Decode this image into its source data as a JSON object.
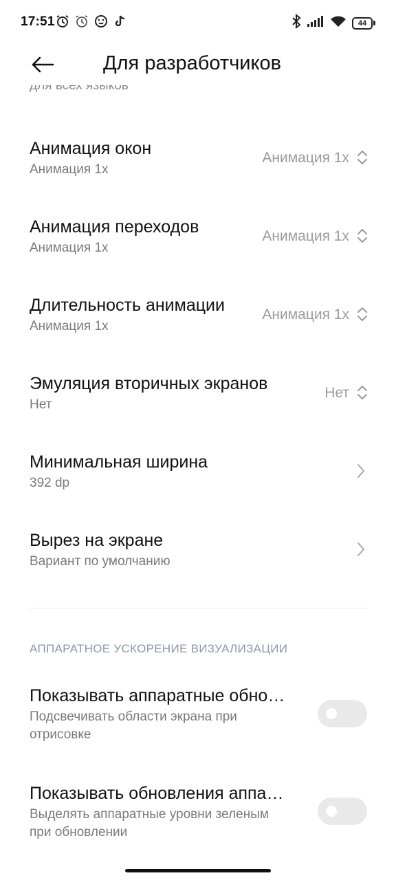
{
  "status_bar": {
    "time": "17:51",
    "battery_level": "44",
    "left_icons": [
      "alarm-icon",
      "alarm-icon",
      "emoji-icon",
      "tiktok-icon"
    ],
    "right_icons": [
      "bluetooth-icon",
      "signal-icon",
      "wifi-icon",
      "battery-icon"
    ]
  },
  "header": {
    "title": "Для разработчиков"
  },
  "cutoff_text": "для всех языков",
  "rows": [
    {
      "title": "Анимация окон",
      "subtitle": "Анимация 1x",
      "value": "Анимация 1x",
      "control": "dropdown"
    },
    {
      "title": "Анимация переходов",
      "subtitle": "Анимация 1x",
      "value": "Анимация 1x",
      "control": "dropdown"
    },
    {
      "title": "Длительность анимации",
      "subtitle": "Анимация 1x",
      "value": "Анимация 1x",
      "control": "dropdown"
    },
    {
      "title": "Эмуляция вторичных экранов",
      "subtitle": "Нет",
      "value": "Нет",
      "control": "dropdown"
    },
    {
      "title": "Минимальная ширина",
      "subtitle": "392 dp",
      "control": "chevron"
    },
    {
      "title": "Вырез на экране",
      "subtitle": "Вариант по умолчанию",
      "control": "chevron"
    }
  ],
  "section": {
    "header": "АППАРАТНОЕ УСКОРЕНИЕ ВИЗУАЛИЗАЦИИ"
  },
  "toggles": [
    {
      "title": "Показывать аппаратные обно…",
      "subtitle_line1": "Подсвечивать области экрана при",
      "subtitle_line2": "отрисовке",
      "enabled": false
    },
    {
      "title": "Показывать обновления аппа…",
      "subtitle_line1": "Выделять аппаратные уровни зеленым",
      "subtitle_line2": "при обновлении",
      "enabled": false
    }
  ],
  "colors": {
    "text_primary": "#111111",
    "text_secondary": "#7a7a7a",
    "section_header": "#8c98ab",
    "toggle_off": "#e9e9e9"
  }
}
